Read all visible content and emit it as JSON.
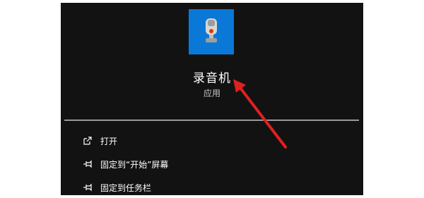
{
  "app": {
    "name": "录音机",
    "type": "应用",
    "tile_color": "#0a78d7",
    "icon": "microphone-icon"
  },
  "menu": {
    "items": [
      {
        "label": "打开",
        "icon": "open-icon"
      },
      {
        "label": "固定到“开始”屏幕",
        "icon": "pin-icon"
      },
      {
        "label": "固定到任务栏",
        "icon": "pin-icon"
      }
    ]
  },
  "annotation": {
    "arrow_color": "#e02020"
  }
}
